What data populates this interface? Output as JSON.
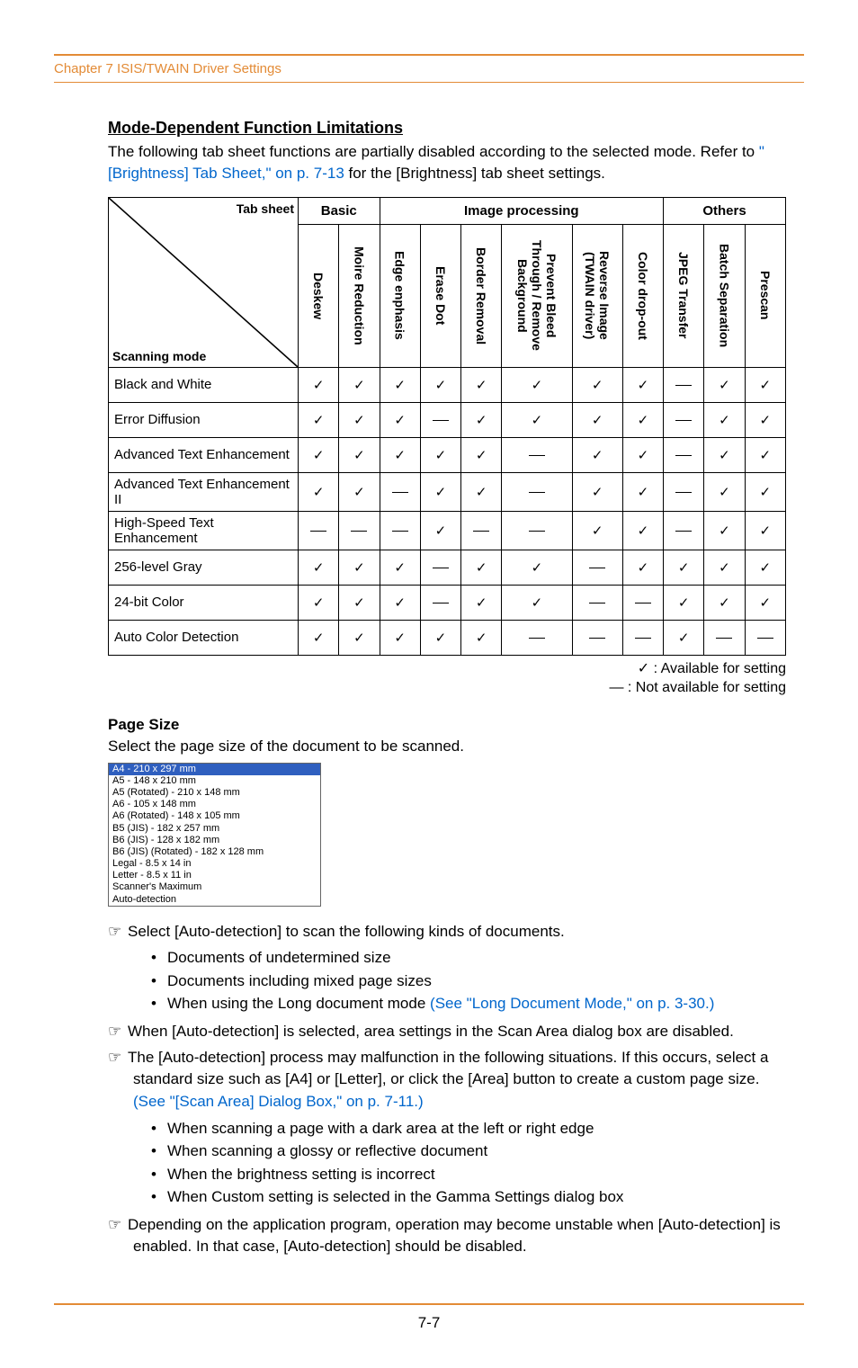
{
  "chapter": "Chapter 7   ISIS/TWAIN Driver Settings",
  "section": {
    "title": "Mode-Dependent Function Limitations",
    "intro_a": "The following tab sheet functions are partially disabled according to the selected mode. Refer to ",
    "intro_link": "\"[Brightness] Tab Sheet,\" on p. 7-13",
    "intro_b": " for the [Brightness] tab sheet settings."
  },
  "table": {
    "corner_top": "Tab sheet",
    "corner_bottom": "Scanning mode",
    "groups": [
      "Basic",
      "Image processing",
      "Others"
    ],
    "columns": [
      "Deskew",
      "Moire Reduction",
      "Edge enphasis",
      "Erase Dot",
      "Border Removal",
      "Prevent Bleed Through / Remove Background",
      "Reverse Image (TWAIN driver)",
      "Color drop-out",
      "JPEG Transfer",
      "Batch Separation",
      "Prescan"
    ],
    "rows": [
      {
        "label": "Black and White",
        "cells": [
          "c",
          "c",
          "c",
          "c",
          "c",
          "c",
          "c",
          "c",
          "d",
          "c",
          "c"
        ]
      },
      {
        "label": "Error Diffusion",
        "cells": [
          "c",
          "c",
          "c",
          "d",
          "c",
          "c",
          "c",
          "c",
          "d",
          "c",
          "c"
        ]
      },
      {
        "label": "Advanced Text Enhancement",
        "cells": [
          "c",
          "c",
          "c",
          "c",
          "c",
          "d",
          "c",
          "c",
          "d",
          "c",
          "c"
        ]
      },
      {
        "label": "Advanced Text Enhancement II",
        "cells": [
          "c",
          "c",
          "d",
          "c",
          "c",
          "d",
          "c",
          "c",
          "d",
          "c",
          "c"
        ]
      },
      {
        "label": "High-Speed Text Enhancement",
        "cells": [
          "d",
          "d",
          "d",
          "c",
          "d",
          "d",
          "c",
          "c",
          "d",
          "c",
          "c"
        ]
      },
      {
        "label": "256-level Gray",
        "cells": [
          "c",
          "c",
          "c",
          "d",
          "c",
          "c",
          "d",
          "c",
          "c",
          "c",
          "c"
        ]
      },
      {
        "label": "24-bit Color",
        "cells": [
          "c",
          "c",
          "c",
          "d",
          "c",
          "c",
          "d",
          "d",
          "c",
          "c",
          "c"
        ]
      },
      {
        "label": "Auto Color Detection",
        "cells": [
          "c",
          "c",
          "c",
          "c",
          "c",
          "d",
          "d",
          "d",
          "c",
          "d",
          "d"
        ]
      }
    ]
  },
  "legend": {
    "avail": "✓ : Available for setting",
    "not_avail": "— : Not available for setting"
  },
  "pagesize": {
    "title": "Page Size",
    "desc": "Select the page size of the document to be scanned.",
    "options": [
      "A4 - 210 x 297 mm",
      "A5 - 148 x 210 mm",
      "A5 (Rotated) - 210 x 148 mm",
      "A6 - 105 x 148 mm",
      "A6 (Rotated) - 148 x 105 mm",
      "B5 (JIS) - 182 x 257 mm",
      "B6 (JIS) - 128 x 182 mm",
      "B6 (JIS) (Rotated) - 182 x 128 mm",
      "Legal - 8.5 x 14 in",
      "Letter - 8.5 x 11 in",
      "Scanner's Maximum",
      "Auto-detection"
    ]
  },
  "notes": {
    "n1": "Select [Auto-detection] to scan the following kinds of documents.",
    "n1_bullets": [
      "Documents of undetermined size",
      "Documents including mixed page sizes",
      "When using the Long document mode "
    ],
    "n1_link": "(See \"Long Document Mode,\" on p. 3-30.)",
    "n2": "When [Auto-detection] is selected, area settings in the Scan Area dialog box are disabled.",
    "n3a": "The [Auto-detection] process may malfunction in the following situations. If this occurs, select a standard size such as [A4] or [Letter], or click the [Area] button to create a custom page size. ",
    "n3_link": "(See \"[Scan Area] Dialog Box,\" on p. 7-11.)",
    "n3_bullets": [
      "When scanning a page with a dark area at the left or right edge",
      "When scanning a glossy or reflective document",
      "When the brightness setting is incorrect",
      "When Custom setting is selected in the Gamma Settings dialog box"
    ],
    "n4": "Depending on the application program, operation may become unstable when [Auto-detection] is enabled. In that case, [Auto-detection] should be disabled."
  },
  "footer": "7-7"
}
